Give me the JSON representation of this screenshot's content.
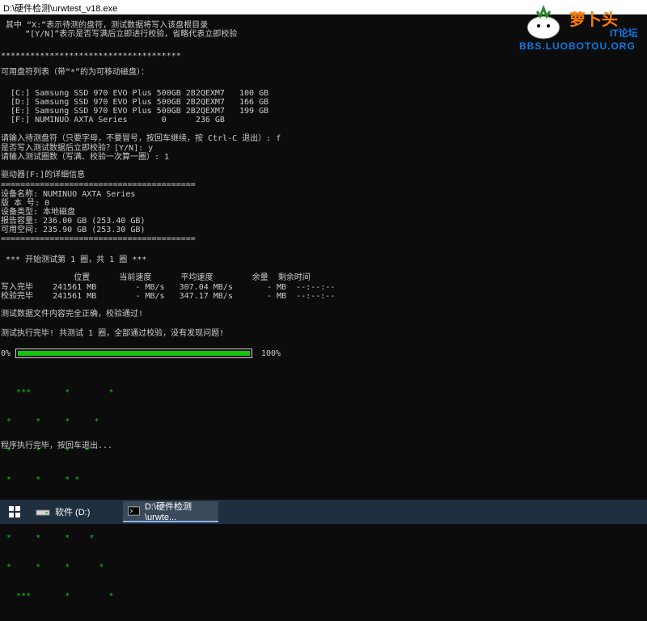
{
  "window": {
    "title": "D:\\硬件检测\\urwtest_v18.exe"
  },
  "console": {
    "lines": [
      " 其中 “X:”表示待测的盘符，测试数据将写入该盘根目录",
      "     “[Y/N]”表示是否写满后立即进行校验，省略代表立即校验",
      "",
      "*************************************",
      "",
      "可用盘符列表（带“*”的为可移动磁盘）：",
      "",
      "  [C:] Samsung SSD 970 EVO Plus 500GB 2B2QEXM7   100 GB",
      "  [D:] Samsung SSD 970 EVO Plus 500GB 2B2QEXM7   166 GB",
      "  [E:] Samsung SSD 970 EVO Plus 500GB 2B2QEXM7   199 GB",
      "  [F:] NUMINUO AXTA Series       0      236 GB",
      "",
      "请输入待测盘符（只要字母，不要冒号，按回车继续，按 Ctrl-C 退出）: f",
      "是否写入测试数据后立即校验？[Y/N]: y",
      "请输入测试圈数（写满、校验一次算一圈）: 1",
      "",
      "驱动器[F:]的详细信息",
      "========================================",
      "设备名称: NUMINUO AXTA Series",
      "版 本 号: 0",
      "设备类型: 本地磁盘",
      "报告容量: 236.00 GB (253.40 GB)",
      "可用空间: 235.90 GB (253.30 GB)",
      "========================================",
      "",
      " *** 开始测试第 1 圈，共 1 圈 ***",
      "",
      "               位置      当前速度      平均速度        余量  剩余时间",
      "写入完毕    241561 MB        - MB/s   307.04 MB/s       - MB  --:--:--",
      "校验完毕    241561 MB        - MB/s   347.17 MB/s       - MB  --:--:--",
      "",
      "测试数据文件内容完全正确，校验通过!",
      "",
      "测试执行完毕! 共测试 1 圈，全部通过校验，没有发现问题!"
    ],
    "progress": {
      "start_label": "0%",
      "end_label": "100%",
      "value": 1.0
    },
    "ok_art": [
      "   ***       *        *",
      " *     *     *     *",
      " *     *     *   *",
      " *     *     * *",
      " *     *     *  **",
      " *     *     *    *",
      " *     *     *      *",
      "   ***       *        *"
    ],
    "exit_line": "程序执行完毕，按回车退出..."
  },
  "watermark": {
    "title": "萝卜头",
    "subtitle": "IT论坛",
    "url": "BBS.LUOBOTOU.ORG"
  },
  "taskbar": {
    "start_icon": "windows-logo-icon",
    "items": [
      {
        "label": "软件 (D:)",
        "icon": "drive-icon"
      },
      {
        "label": "D:\\硬件检测\\urwte...",
        "icon": "console-icon"
      }
    ]
  },
  "colors": {
    "console_bg": "#0c0c0c",
    "console_text": "#cccccc",
    "ok_green": "#16c60c",
    "taskbar_bg": "#1f2f3f"
  }
}
